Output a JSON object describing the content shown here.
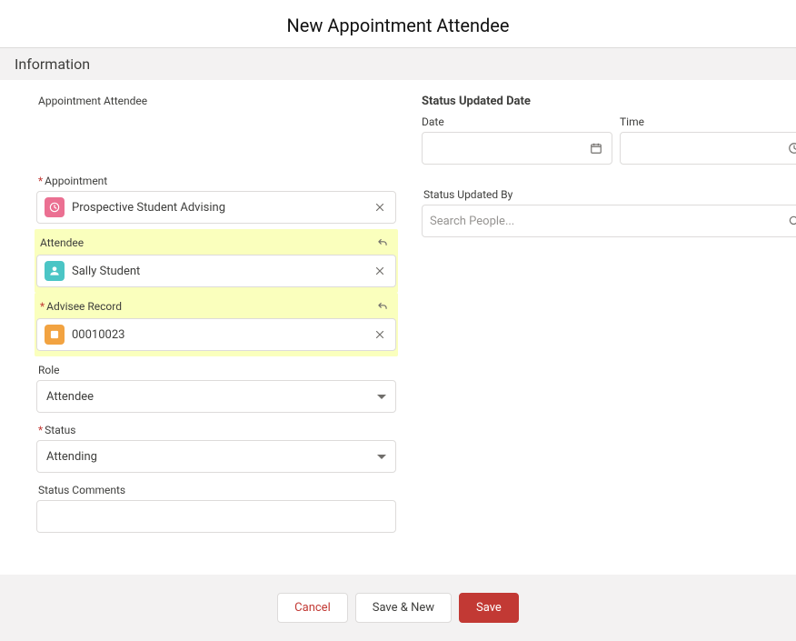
{
  "page_title": "New Appointment Attendee",
  "section_title": "Information",
  "left": {
    "appointment_attendee_label": "Appointment Attendee",
    "appointment_label": "Appointment",
    "appointment_value": "Prospective Student Advising",
    "attendee_label": "Attendee",
    "attendee_value": "Sally Student",
    "advisee_record_label": "Advisee Record",
    "advisee_record_value": "00010023",
    "role_label": "Role",
    "role_value": "Attendee",
    "status_label": "Status",
    "status_value": "Attending",
    "status_comments_label": "Status Comments"
  },
  "right": {
    "status_updated_date_label": "Status Updated Date",
    "date_label": "Date",
    "time_label": "Time",
    "status_updated_by_label": "Status Updated By",
    "search_people_placeholder": "Search People..."
  },
  "footer": {
    "cancel": "Cancel",
    "save_new": "Save & New",
    "save": "Save"
  }
}
